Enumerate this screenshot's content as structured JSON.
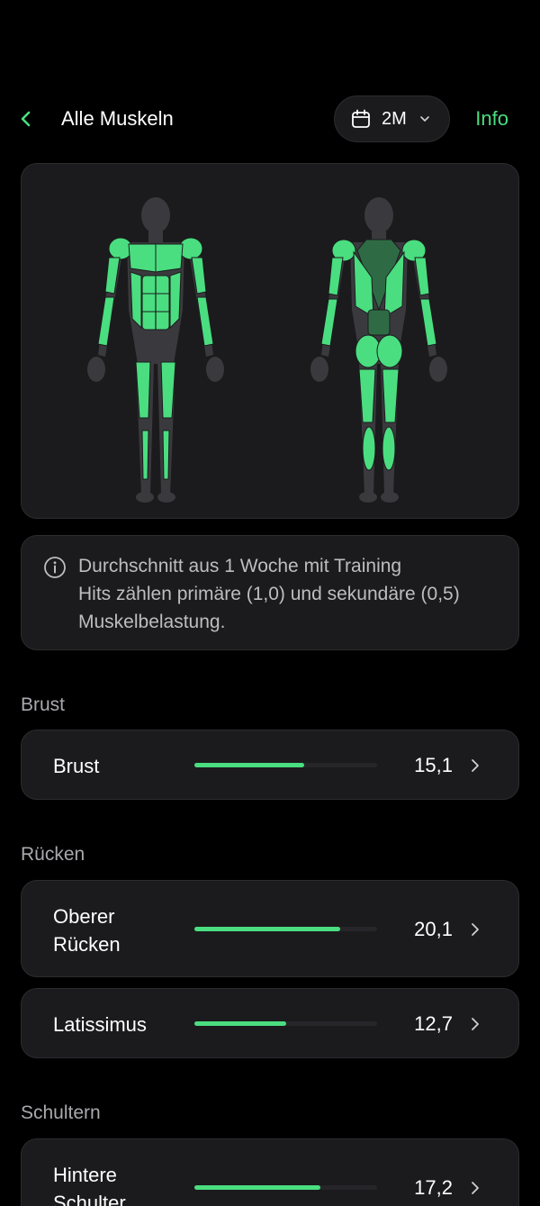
{
  "header": {
    "title": "Alle Muskeln",
    "range_label": "2M",
    "info_label": "Info",
    "accent_color": "#4ade80"
  },
  "body_map": {
    "views": [
      "front",
      "back"
    ],
    "active_color": "#4ade80",
    "inactive_color": "#3a3a3e"
  },
  "info": {
    "line1": "Durchschnitt aus 1 Woche mit Training",
    "line2": "Hits zählen primäre (1,0) und sekundäre (0,5) Muskelbelastung."
  },
  "sections": [
    {
      "title": "Brust",
      "rows": [
        {
          "label": "Brust",
          "value": "15,1",
          "fill": 0.6
        }
      ]
    },
    {
      "title": "Rücken",
      "rows": [
        {
          "label": "Oberer Rücken",
          "value": "20,1",
          "fill": 0.8
        },
        {
          "label": "Latissimus",
          "value": "12,7",
          "fill": 0.5
        }
      ]
    },
    {
      "title": "Schultern",
      "rows": [
        {
          "label": "Hintere Schulter",
          "value": "17,2",
          "fill": 0.69
        }
      ]
    }
  ]
}
